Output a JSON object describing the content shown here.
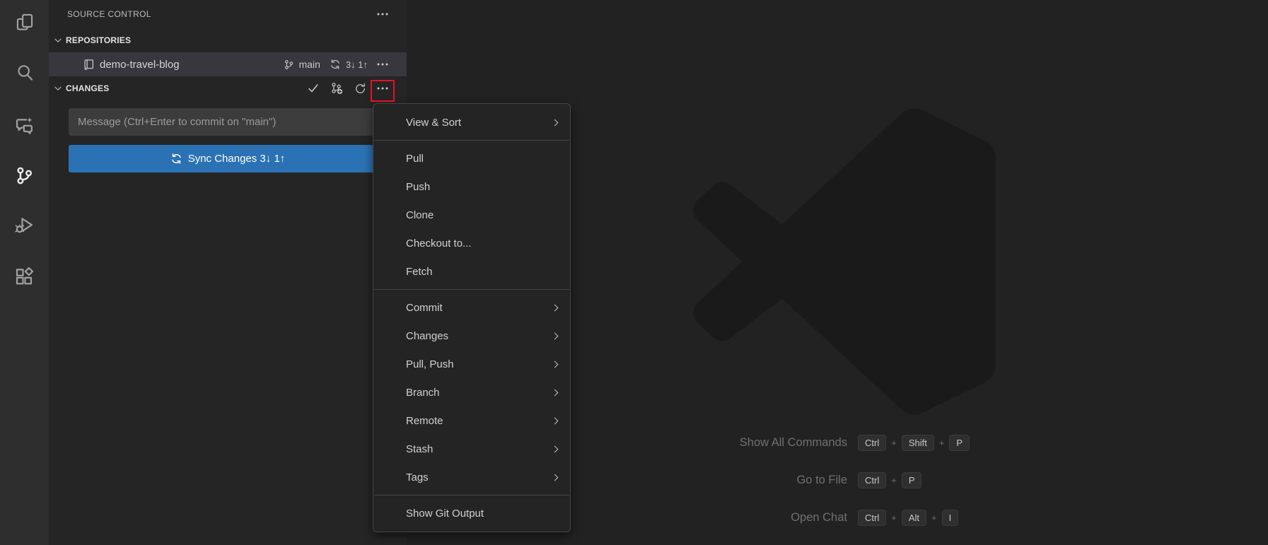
{
  "colors": {
    "activitybar_bg": "#2e2e2e",
    "sidebar_bg": "#252526",
    "selected_row_bg": "#37373d",
    "editor_bg": "#222223",
    "button_blue": "#2b72b5",
    "menu_bg": "#242425",
    "annotation_red": "#e81123"
  },
  "activity_bar": {
    "icons": [
      "copy-files-icon",
      "search-icon",
      "chat-sparkle-icon",
      "source-control-icon",
      "run-debug-icon",
      "extensions-icon"
    ],
    "active": "source-control-icon"
  },
  "sidebar": {
    "title": "SOURCE CONTROL",
    "repositories_section": {
      "label": "REPOSITORIES"
    },
    "repo": {
      "name": "demo-travel-blog",
      "branch": "main",
      "sync_counts": "3↓ 1↑"
    },
    "changes_section": {
      "label": "CHANGES"
    },
    "commit_input": {
      "value": "",
      "placeholder": "Message (Ctrl+Enter to commit on \"main\")"
    },
    "sync_button_label": "Sync Changes 3↓ 1↑"
  },
  "context_menu": {
    "items": [
      {
        "label": "View & Sort",
        "submenu": true
      },
      {
        "separator": true
      },
      {
        "label": "Pull"
      },
      {
        "label": "Push"
      },
      {
        "label": "Clone"
      },
      {
        "label": "Checkout to..."
      },
      {
        "label": "Fetch"
      },
      {
        "separator": true
      },
      {
        "label": "Commit",
        "submenu": true
      },
      {
        "label": "Changes",
        "submenu": true
      },
      {
        "label": "Pull, Push",
        "submenu": true
      },
      {
        "label": "Branch",
        "submenu": true
      },
      {
        "label": "Remote",
        "submenu": true
      },
      {
        "label": "Stash",
        "submenu": true
      },
      {
        "label": "Tags",
        "submenu": true
      },
      {
        "separator": true
      },
      {
        "label": "Show Git Output"
      }
    ]
  },
  "editor_watermark": {
    "shortcuts": [
      {
        "label": "Show All Commands",
        "keys": [
          "Ctrl",
          "Shift",
          "P"
        ]
      },
      {
        "label": "Go to File",
        "keys": [
          "Ctrl",
          "P"
        ]
      },
      {
        "label": "Open Chat",
        "keys": [
          "Ctrl",
          "Alt",
          "I"
        ]
      }
    ]
  }
}
